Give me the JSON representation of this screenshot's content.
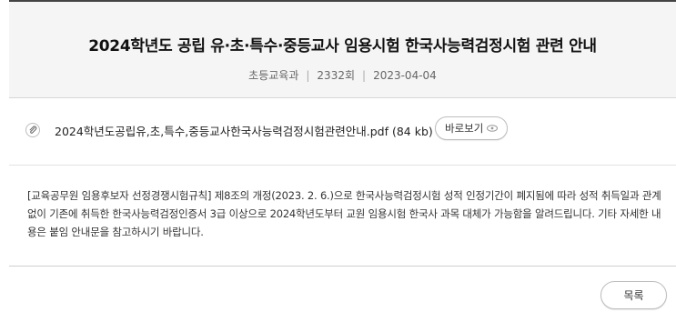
{
  "post": {
    "title": "2024학년도 공립 유·초·특수·중등교사 임용시험 한국사능력검정시험 관련 안내",
    "department": "초등교육과",
    "views": "2332회",
    "date": "2023-04-04",
    "separator": "|"
  },
  "attachment": {
    "icon": "paperclip-icon",
    "file_name": "2024학년도공립유,초,특수,중등교사한국사능력검정시험관련안내.pdf (84 kb)",
    "preview_label": "바로보기"
  },
  "content": {
    "text": "[교육공무원 임용후보자 선정경쟁시험규칙] 제8조의 개정(2023. 2. 6.)으로 한국사능력검정시험 성적 인정기간이 폐지됨에 따라 성적 취득일과 관계없이 기존에 취득한 한국사능력검정인증서 3급 이상으로 2024학년도부터 교원 임용시험 한국사 과목 대체가 가능함을 알려드립니다. 기타 자세한 내용은 붙임 안내문을 참고하시기 바랍니다."
  },
  "actions": {
    "list_label": "목록"
  },
  "colors": {
    "header_bg": "#f5f5f5",
    "header_top_border": "#444444"
  }
}
